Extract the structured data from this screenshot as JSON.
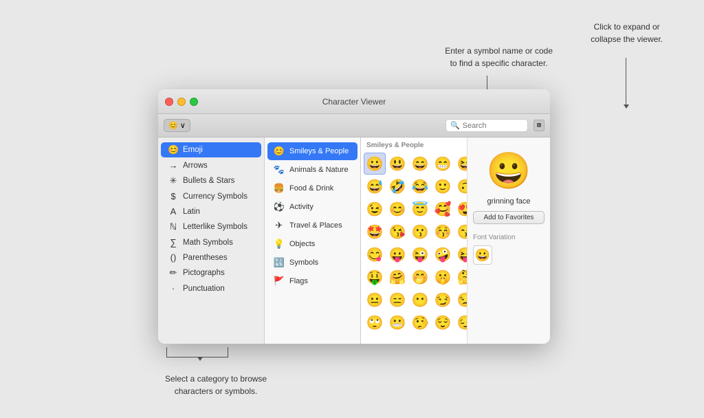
{
  "callouts": {
    "top_right": "Click to expand or\ncollapse the viewer.",
    "top_middle_line1": "Enter a symbol name or code",
    "top_middle_line2": "to find a specific character.",
    "bottom_line1": "Select a category to browse",
    "bottom_line2": "characters or symbols."
  },
  "window": {
    "title": "Character Viewer"
  },
  "toolbar": {
    "emoji_btn": "😊 ∨",
    "search_placeholder": "Search",
    "expand_btn": "⊞"
  },
  "sidebar": {
    "items": [
      {
        "id": "emoji",
        "icon": "😊",
        "label": "Emoji",
        "active": true
      },
      {
        "id": "arrows",
        "icon": "→",
        "label": "Arrows",
        "active": false
      },
      {
        "id": "bullets",
        "icon": "✳",
        "label": "Bullets & Stars",
        "active": false
      },
      {
        "id": "currency",
        "icon": "$",
        "label": "Currency Symbols",
        "active": false
      },
      {
        "id": "latin",
        "icon": "A",
        "label": "Latin",
        "active": false
      },
      {
        "id": "letterlike",
        "icon": "ℕ",
        "label": "Letterlike Symbols",
        "active": false
      },
      {
        "id": "math",
        "icon": "∑",
        "label": "Math Symbols",
        "active": false
      },
      {
        "id": "parentheses",
        "icon": "()",
        "label": "Parentheses",
        "active": false
      },
      {
        "id": "pictographs",
        "icon": "✏",
        "label": "Pictographs",
        "active": false
      },
      {
        "id": "punctuation",
        "icon": "·,",
        "label": "Punctuation",
        "active": false
      }
    ]
  },
  "categories": {
    "header": "Smileys & People",
    "items": [
      {
        "id": "smileys",
        "icon": "😊",
        "label": "Smileys & People",
        "active": true
      },
      {
        "id": "animals",
        "icon": "🐾",
        "label": "Animals & Nature",
        "active": false
      },
      {
        "id": "food",
        "icon": "🍔",
        "label": "Food & Drink",
        "active": false
      },
      {
        "id": "activity",
        "icon": "⚽",
        "label": "Activity",
        "active": false
      },
      {
        "id": "travel",
        "icon": "✈",
        "label": "Travel & Places",
        "active": false
      },
      {
        "id": "objects",
        "icon": "💡",
        "label": "Objects",
        "active": false
      },
      {
        "id": "symbols",
        "icon": "🔣",
        "label": "Symbols",
        "active": false
      },
      {
        "id": "flags",
        "icon": "🚩",
        "label": "Flags",
        "active": false
      }
    ]
  },
  "emoji_grid": {
    "section": "Smileys & People",
    "emojis": [
      "😀",
      "😃",
      "😄",
      "😁",
      "😆",
      "😅",
      "🤣",
      "😂",
      "🙂",
      "🙃",
      "😉",
      "😊",
      "😇",
      "🥰",
      "😍",
      "🤩",
      "😘",
      "😗",
      "😚",
      "😙",
      "😋",
      "😛",
      "😜",
      "🤪",
      "😝",
      "🤑",
      "🤗",
      "🤭",
      "🤫",
      "🤔",
      "😐",
      "😑",
      "😶",
      "😏",
      "😒",
      "🙄",
      "😬",
      "🤥",
      "😌",
      "😔"
    ],
    "selected_index": 0
  },
  "detail": {
    "emoji": "😀",
    "name": "grinning face",
    "add_favorites_label": "Add to Favorites",
    "font_variation_label": "Font Variation",
    "variations": [
      "😀"
    ]
  }
}
